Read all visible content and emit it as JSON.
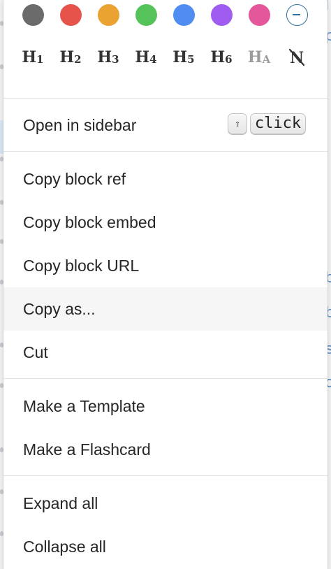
{
  "colors": [
    {
      "name": "gray",
      "hex": "#6b6b6b"
    },
    {
      "name": "red",
      "hex": "#e5534b"
    },
    {
      "name": "yellow",
      "hex": "#eaa230"
    },
    {
      "name": "green",
      "hex": "#56c35a"
    },
    {
      "name": "blue",
      "hex": "#4f8ef0"
    },
    {
      "name": "purple",
      "hex": "#a05cf0"
    },
    {
      "name": "pink",
      "hex": "#e4579a"
    },
    {
      "name": "none",
      "icon": "minus-circle-icon"
    }
  ],
  "headings": [
    {
      "letter": "H",
      "sub": "1"
    },
    {
      "letter": "H",
      "sub": "2"
    },
    {
      "letter": "H",
      "sub": "3"
    },
    {
      "letter": "H",
      "sub": "4"
    },
    {
      "letter": "H",
      "sub": "5"
    },
    {
      "letter": "H",
      "sub": "6"
    },
    {
      "letter": "H",
      "sub": "A"
    },
    {
      "letter": "N",
      "icon": "no-heading-icon"
    }
  ],
  "menu": {
    "open_in_sidebar": "Open in sidebar",
    "shortcut_shift": "⇧",
    "shortcut_click": "click",
    "copy_block_ref": "Copy block ref",
    "copy_block_embed": "Copy block embed",
    "copy_block_url": "Copy block URL",
    "copy_as": "Copy as...",
    "cut": "Cut",
    "make_template": "Make a Template",
    "make_flashcard": "Make a Flashcard",
    "expand_all": "Expand all",
    "collapse_all": "Collapse all"
  },
  "background_edge": [
    "l",
    "p",
    "b",
    "b",
    "s",
    "c"
  ]
}
